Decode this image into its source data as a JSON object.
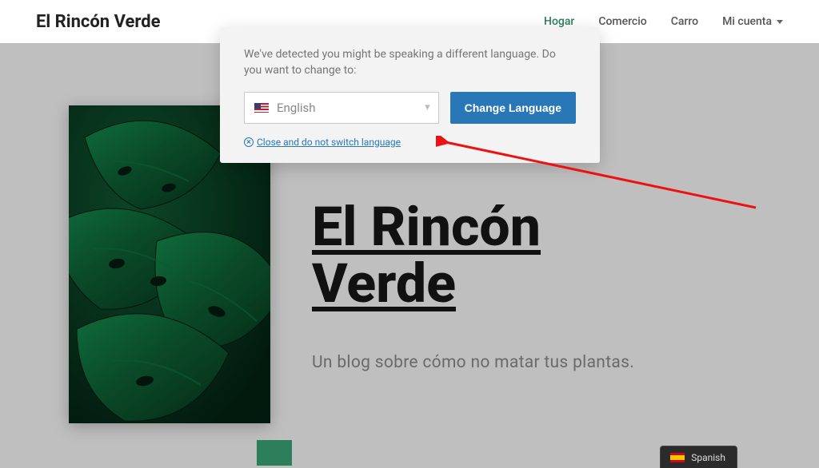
{
  "header": {
    "site_title": "El Rincón Verde",
    "nav": [
      {
        "label": "Hogar",
        "active": true
      },
      {
        "label": "Comercio"
      },
      {
        "label": "Carro"
      },
      {
        "label": "Mi cuenta",
        "has_submenu": true
      }
    ]
  },
  "popup": {
    "message": "We've detected you might be speaking a different language. Do you want to change to:",
    "selected_language": "English",
    "button": "Change Language",
    "close_text": "Close and do not switch language"
  },
  "hero": {
    "title": "El Rincón Verde",
    "subtitle": "Un blog sobre cómo no matar tus plantas."
  },
  "lang_tab": {
    "label": "Spanish"
  }
}
